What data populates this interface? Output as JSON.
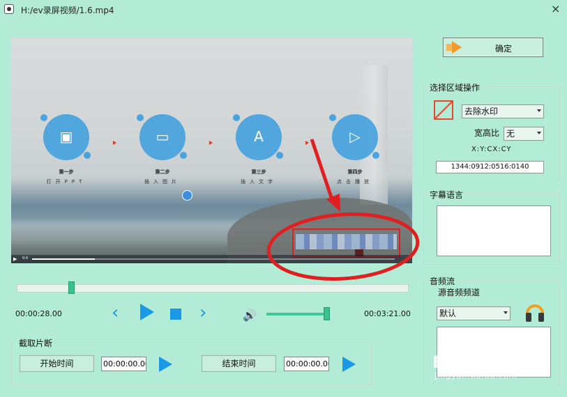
{
  "window": {
    "title": "H:/ev录屏视频/1.6.mp4",
    "close_label": "×"
  },
  "preview": {
    "steps": [
      {
        "title": "第一步",
        "subtitle": "打开PPT",
        "glyph": "▣"
      },
      {
        "title": "第二步",
        "subtitle": "插入图片",
        "glyph": "▭"
      },
      {
        "title": "第三步",
        "subtitle": "插入文字",
        "glyph": "A"
      },
      {
        "title": "第四步",
        "subtitle": "点击播放",
        "glyph": "▷"
      }
    ],
    "mini_time": "0:0"
  },
  "playback": {
    "current_time": "00:00:28.00",
    "total_time": "00:03:21.00",
    "position": 0.139,
    "volume": 0.95,
    "prev_glyph": "‹",
    "next_glyph": "›",
    "volume_glyph": "🔊"
  },
  "clip": {
    "legend": "截取片断",
    "start_button": "开始时间",
    "start_value": "00:00:00.00",
    "end_button": "结束时间",
    "end_value": "00:00:00.00"
  },
  "right_panel": {
    "ok_button": "确定",
    "region": {
      "legend": "选择区域操作",
      "operation": "去除水印",
      "aspect_label": "宽高比",
      "aspect_value": "无",
      "coord_header": "X:Y:CX:CY",
      "coord_value": "1344:0912:0516:0140"
    },
    "subtitle": {
      "legend": "字幕语言"
    },
    "audio": {
      "legend": "音频流",
      "channel_label": "源音频频道",
      "channel_value": "默认"
    }
  },
  "watermark": {
    "brand": "Baidu经验",
    "url": "jingyan.baidu.com"
  },
  "colors": {
    "background": "#b2ecd6",
    "accent": "#1a9ae6",
    "slider": "#3cc08e",
    "annotation": "#e02020"
  }
}
